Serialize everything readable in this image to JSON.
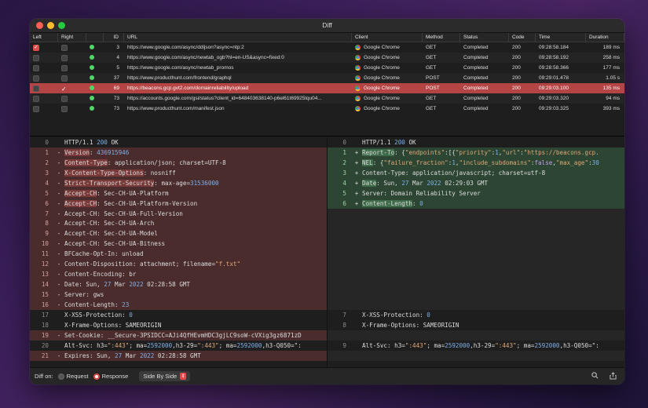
{
  "window": {
    "title": "Diff"
  },
  "columns": {
    "left": "Left",
    "right": "Right",
    "id": "ID",
    "url": "URL",
    "client": "Client",
    "method": "Method",
    "status": "Status",
    "code": "Code",
    "time": "Time",
    "duration": "Duration"
  },
  "rows": [
    {
      "left": "on",
      "right": "off",
      "id": "3",
      "url": "https://www.google.com/async/ddljson?async=ntp:2",
      "client": "Google Chrome",
      "method": "GET",
      "status": "Completed",
      "code": "200",
      "time": "09:28:58.184",
      "duration": "189 ms"
    },
    {
      "left": "off",
      "right": "off",
      "id": "4",
      "url": "https://www.google.com/async/newtab_ogb?hl=en-US&async=fixed:0",
      "client": "Google Chrome",
      "method": "GET",
      "status": "Completed",
      "code": "200",
      "time": "09:28:58.192",
      "duration": "258 ms"
    },
    {
      "left": "off",
      "right": "off",
      "id": "5",
      "url": "https://www.google.com/async/newtab_promos",
      "client": "Google Chrome",
      "method": "GET",
      "status": "Completed",
      "code": "200",
      "time": "09:28:58.366",
      "duration": "177 ms"
    },
    {
      "left": "off",
      "right": "off",
      "id": "37",
      "url": "https://www.producthunt.com/frontend/graphql",
      "client": "Google Chrome",
      "method": "POST",
      "status": "Completed",
      "code": "200",
      "time": "09:29:01.478",
      "duration": "1.05 s"
    },
    {
      "left": "off",
      "right": "on",
      "id": "69",
      "url": "https://beacons.gcp.gvt2.com/domainreliability/upload",
      "client": "Google Chrome",
      "method": "POST",
      "status": "Completed",
      "code": "200",
      "time": "09:29:03.100",
      "duration": "135 ms",
      "selected": true
    },
    {
      "left": "off",
      "right": "off",
      "id": "73",
      "url": "https://accounts.google.com/gsi/status?client_id=648403638140-p6el61t69925lqu04...",
      "client": "Google Chrome",
      "method": "GET",
      "status": "Completed",
      "code": "200",
      "time": "09:29:03.320",
      "duration": "94 ms"
    },
    {
      "left": "off",
      "right": "off",
      "id": "73",
      "url": "https://www.producthunt.com/manifest.json",
      "client": "Google Chrome",
      "method": "GET",
      "status": "Completed",
      "code": "200",
      "time": "09:29:03.325",
      "duration": "393 ms"
    }
  ],
  "left_pane": [
    {
      "n": "0",
      "m": "",
      "type": "ctx",
      "segs": [
        [
          "HTTP/1.1 ",
          ""
        ],
        [
          "200",
          "num"
        ],
        [
          " OK",
          ""
        ]
      ]
    },
    {
      "n": "1",
      "m": "-",
      "type": "del",
      "segs": [
        [
          "Version",
          "hl"
        ],
        [
          ": ",
          ""
        ],
        [
          "436915946",
          "num"
        ]
      ]
    },
    {
      "n": "2",
      "m": "-",
      "type": "del",
      "segs": [
        [
          "Content-Type",
          "hl"
        ],
        [
          ": application/json; charset=UTF-8",
          ""
        ]
      ]
    },
    {
      "n": "3",
      "m": "-",
      "type": "del",
      "segs": [
        [
          "X-Content-Type-Options",
          "hl"
        ],
        [
          ": nosniff",
          ""
        ]
      ]
    },
    {
      "n": "4",
      "m": "-",
      "type": "del",
      "segs": [
        [
          "Strict-Transport-Security",
          "hl"
        ],
        [
          ": max-age=",
          ""
        ],
        [
          "31536000",
          "num"
        ]
      ]
    },
    {
      "n": "5",
      "m": "-",
      "type": "del",
      "segs": [
        [
          "Accept-CH",
          "hl"
        ],
        [
          ": Sec-CH-UA-Platform",
          ""
        ]
      ]
    },
    {
      "n": "6",
      "m": "-",
      "type": "del",
      "segs": [
        [
          "Accept-CH",
          "hl"
        ],
        [
          ": Sec-CH-UA-Platform-Version",
          ""
        ]
      ]
    },
    {
      "n": "7",
      "m": "-",
      "type": "del",
      "segs": [
        [
          "Accept-CH: Sec-CH-UA-Full-Version",
          ""
        ]
      ]
    },
    {
      "n": "8",
      "m": "-",
      "type": "del",
      "segs": [
        [
          "Accept-CH: Sec-CH-UA-Arch",
          ""
        ]
      ]
    },
    {
      "n": "9",
      "m": "-",
      "type": "del",
      "segs": [
        [
          "Accept-CH: Sec-CH-UA-Model",
          ""
        ]
      ]
    },
    {
      "n": "10",
      "m": "-",
      "type": "del",
      "segs": [
        [
          "Accept-CH: Sec-CH-UA-Bitness",
          ""
        ]
      ]
    },
    {
      "n": "11",
      "m": "-",
      "type": "del",
      "segs": [
        [
          "BFCache-Opt-In: unload",
          ""
        ]
      ]
    },
    {
      "n": "12",
      "m": "-",
      "type": "del",
      "segs": [
        [
          "Content-Disposition: attachment; filename=",
          ""
        ],
        [
          "\"f.txt\"",
          "str"
        ]
      ]
    },
    {
      "n": "13",
      "m": "-",
      "type": "del",
      "segs": [
        [
          "Content-Encoding: br",
          ""
        ]
      ]
    },
    {
      "n": "14",
      "m": "-",
      "type": "del",
      "segs": [
        [
          "Date: Sun, ",
          ""
        ],
        [
          "27",
          "num"
        ],
        [
          " Mar ",
          ""
        ],
        [
          "2022",
          "num"
        ],
        [
          " 02:28:58 GMT",
          ""
        ]
      ]
    },
    {
      "n": "15",
      "m": "-",
      "type": "del",
      "segs": [
        [
          "Server: gws",
          ""
        ]
      ]
    },
    {
      "n": "16",
      "m": "-",
      "type": "del",
      "segs": [
        [
          "Content-Length: ",
          ""
        ],
        [
          "23",
          "num"
        ]
      ]
    },
    {
      "n": "17",
      "m": "",
      "type": "ctx",
      "segs": [
        [
          "X-XSS-Protection: ",
          ""
        ],
        [
          "0",
          "num"
        ]
      ]
    },
    {
      "n": "18",
      "m": "",
      "type": "ctx",
      "segs": [
        [
          "X-Frame-Options: SAMEORIGIN",
          ""
        ]
      ]
    },
    {
      "n": "19",
      "m": "-",
      "type": "del",
      "segs": [
        [
          "Set-Cookie: __Secure-3PSIDCC=AJi4QfHEvmHDC3gjLC9soW-cVXig3gz6871zD",
          ""
        ]
      ]
    },
    {
      "n": "20",
      "m": "",
      "type": "ctx",
      "segs": [
        [
          "Alt-Svc: h3=",
          ""
        ],
        [
          "\":443\"",
          "str"
        ],
        [
          "; ma=",
          ""
        ],
        [
          "2592000",
          "num"
        ],
        [
          ",h3-29=",
          ""
        ],
        [
          "\":443\"",
          "str"
        ],
        [
          "; ma=",
          ""
        ],
        [
          "2592000",
          "num"
        ],
        [
          ",h3-Q050=\":",
          ""
        ]
      ]
    },
    {
      "n": "21",
      "m": "-",
      "type": "del",
      "segs": [
        [
          "Expires: Sun, ",
          ""
        ],
        [
          "27",
          "num"
        ],
        [
          " Mar ",
          ""
        ],
        [
          "2022",
          "num"
        ],
        [
          " 02:28:58 GMT",
          ""
        ]
      ]
    }
  ],
  "right_pane": [
    {
      "n": "0",
      "m": "",
      "type": "ctx",
      "segs": [
        [
          "HTTP/1.1 ",
          ""
        ],
        [
          "200",
          "num"
        ],
        [
          " OK",
          ""
        ]
      ]
    },
    {
      "n": "1",
      "m": "+",
      "type": "add",
      "segs": [
        [
          "Report-To",
          "hl"
        ],
        [
          ": {",
          ""
        ],
        [
          "\"endpoints\"",
          "str"
        ],
        [
          ":[{",
          ""
        ],
        [
          "\"priority\"",
          "str"
        ],
        [
          ":",
          ""
        ],
        [
          "1",
          "num"
        ],
        [
          ",",
          ""
        ],
        [
          "\"url\"",
          "str"
        ],
        [
          ":",
          ""
        ],
        [
          "\"https://beacons.gcp.",
          "str"
        ]
      ]
    },
    {
      "n": "2",
      "m": "+",
      "type": "add",
      "segs": [
        [
          "NEL",
          "hl"
        ],
        [
          ": {",
          ""
        ],
        [
          "\"failure_fraction\"",
          "str"
        ],
        [
          ":",
          ""
        ],
        [
          "1",
          "num"
        ],
        [
          ",",
          ""
        ],
        [
          "\"include_subdomains\"",
          "str"
        ],
        [
          ":",
          ""
        ],
        [
          "false",
          "kw"
        ],
        [
          ",",
          ""
        ],
        [
          "\"max_age\"",
          "str"
        ],
        [
          ":",
          ""
        ],
        [
          "30",
          "num"
        ]
      ]
    },
    {
      "n": "3",
      "m": "+",
      "type": "add",
      "segs": [
        [
          "Content-Type: application/javascript; charset=utf-8",
          ""
        ]
      ]
    },
    {
      "n": "4",
      "m": "+",
      "type": "add",
      "segs": [
        [
          "Date",
          "hl"
        ],
        [
          ": Sun, ",
          ""
        ],
        [
          "27",
          "num"
        ],
        [
          " Mar ",
          ""
        ],
        [
          "2022",
          "num"
        ],
        [
          " 02:29:03 GMT",
          ""
        ]
      ]
    },
    {
      "n": "5",
      "m": "+",
      "type": "add",
      "segs": [
        [
          "Server: Domain Reliability Server",
          ""
        ]
      ]
    },
    {
      "n": "6",
      "m": "+",
      "type": "add",
      "segs": [
        [
          "Content-Length",
          "hl"
        ],
        [
          ": ",
          ""
        ],
        [
          "0",
          "num"
        ]
      ]
    },
    {
      "n": "",
      "m": "",
      "type": "blank",
      "segs": []
    },
    {
      "n": "",
      "m": "",
      "type": "blank",
      "segs": []
    },
    {
      "n": "",
      "m": "",
      "type": "blank",
      "segs": []
    },
    {
      "n": "",
      "m": "",
      "type": "blank",
      "segs": []
    },
    {
      "n": "",
      "m": "",
      "type": "blank",
      "segs": []
    },
    {
      "n": "",
      "m": "",
      "type": "blank",
      "segs": []
    },
    {
      "n": "",
      "m": "",
      "type": "blank",
      "segs": []
    },
    {
      "n": "",
      "m": "",
      "type": "blank",
      "segs": []
    },
    {
      "n": "",
      "m": "",
      "type": "blank",
      "segs": []
    },
    {
      "n": "",
      "m": "",
      "type": "blank",
      "segs": []
    },
    {
      "n": "7",
      "m": "",
      "type": "ctx",
      "segs": [
        [
          "X-XSS-Protection: ",
          ""
        ],
        [
          "0",
          "num"
        ]
      ]
    },
    {
      "n": "8",
      "m": "",
      "type": "ctx",
      "segs": [
        [
          "X-Frame-Options: SAMEORIGIN",
          ""
        ]
      ]
    },
    {
      "n": "",
      "m": "",
      "type": "blank",
      "segs": []
    },
    {
      "n": "9",
      "m": "",
      "type": "ctx",
      "segs": [
        [
          "Alt-Svc: h3=",
          ""
        ],
        [
          "\":443\"",
          "str"
        ],
        [
          "; ma=",
          ""
        ],
        [
          "2592000",
          "num"
        ],
        [
          ",h3-29=",
          ""
        ],
        [
          "\":443\"",
          "str"
        ],
        [
          "; ma=",
          ""
        ],
        [
          "2592000",
          "num"
        ],
        [
          ",h3-Q050=\":",
          ""
        ]
      ]
    },
    {
      "n": "",
      "m": "",
      "type": "blank",
      "segs": []
    }
  ],
  "footer": {
    "diff_on_label": "Diff on:",
    "request_label": "Request",
    "response_label": "Response",
    "mode_label": "Side By Side",
    "search_icon": "search-icon",
    "share_icon": "share-icon"
  },
  "colors": {
    "accent": "#e04a4a",
    "selected_row": "#b54444",
    "deleted_line": "#4a2c2c",
    "added_line": "#2c4633"
  }
}
